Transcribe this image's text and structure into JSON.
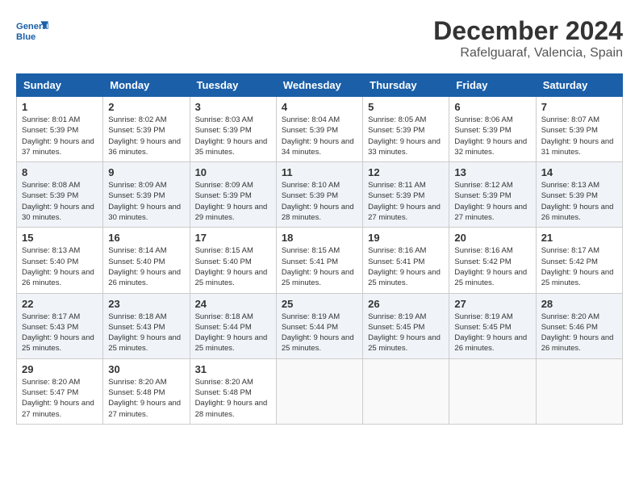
{
  "logo": {
    "name": "GeneralBlue",
    "alt": "General Blue Logo"
  },
  "title": "December 2024",
  "subtitle": "Rafelguaraf, Valencia, Spain",
  "weekdays": [
    "Sunday",
    "Monday",
    "Tuesday",
    "Wednesday",
    "Thursday",
    "Friday",
    "Saturday"
  ],
  "weeks": [
    [
      {
        "day": 1,
        "sunrise": "Sunrise: 8:01 AM",
        "sunset": "Sunset: 5:39 PM",
        "daylight": "Daylight: 9 hours and 37 minutes."
      },
      {
        "day": 2,
        "sunrise": "Sunrise: 8:02 AM",
        "sunset": "Sunset: 5:39 PM",
        "daylight": "Daylight: 9 hours and 36 minutes."
      },
      {
        "day": 3,
        "sunrise": "Sunrise: 8:03 AM",
        "sunset": "Sunset: 5:39 PM",
        "daylight": "Daylight: 9 hours and 35 minutes."
      },
      {
        "day": 4,
        "sunrise": "Sunrise: 8:04 AM",
        "sunset": "Sunset: 5:39 PM",
        "daylight": "Daylight: 9 hours and 34 minutes."
      },
      {
        "day": 5,
        "sunrise": "Sunrise: 8:05 AM",
        "sunset": "Sunset: 5:39 PM",
        "daylight": "Daylight: 9 hours and 33 minutes."
      },
      {
        "day": 6,
        "sunrise": "Sunrise: 8:06 AM",
        "sunset": "Sunset: 5:39 PM",
        "daylight": "Daylight: 9 hours and 32 minutes."
      },
      {
        "day": 7,
        "sunrise": "Sunrise: 8:07 AM",
        "sunset": "Sunset: 5:39 PM",
        "daylight": "Daylight: 9 hours and 31 minutes."
      }
    ],
    [
      {
        "day": 8,
        "sunrise": "Sunrise: 8:08 AM",
        "sunset": "Sunset: 5:39 PM",
        "daylight": "Daylight: 9 hours and 30 minutes."
      },
      {
        "day": 9,
        "sunrise": "Sunrise: 8:09 AM",
        "sunset": "Sunset: 5:39 PM",
        "daylight": "Daylight: 9 hours and 30 minutes."
      },
      {
        "day": 10,
        "sunrise": "Sunrise: 8:09 AM",
        "sunset": "Sunset: 5:39 PM",
        "daylight": "Daylight: 9 hours and 29 minutes."
      },
      {
        "day": 11,
        "sunrise": "Sunrise: 8:10 AM",
        "sunset": "Sunset: 5:39 PM",
        "daylight": "Daylight: 9 hours and 28 minutes."
      },
      {
        "day": 12,
        "sunrise": "Sunrise: 8:11 AM",
        "sunset": "Sunset: 5:39 PM",
        "daylight": "Daylight: 9 hours and 27 minutes."
      },
      {
        "day": 13,
        "sunrise": "Sunrise: 8:12 AM",
        "sunset": "Sunset: 5:39 PM",
        "daylight": "Daylight: 9 hours and 27 minutes."
      },
      {
        "day": 14,
        "sunrise": "Sunrise: 8:13 AM",
        "sunset": "Sunset: 5:39 PM",
        "daylight": "Daylight: 9 hours and 26 minutes."
      }
    ],
    [
      {
        "day": 15,
        "sunrise": "Sunrise: 8:13 AM",
        "sunset": "Sunset: 5:40 PM",
        "daylight": "Daylight: 9 hours and 26 minutes."
      },
      {
        "day": 16,
        "sunrise": "Sunrise: 8:14 AM",
        "sunset": "Sunset: 5:40 PM",
        "daylight": "Daylight: 9 hours and 26 minutes."
      },
      {
        "day": 17,
        "sunrise": "Sunrise: 8:15 AM",
        "sunset": "Sunset: 5:40 PM",
        "daylight": "Daylight: 9 hours and 25 minutes."
      },
      {
        "day": 18,
        "sunrise": "Sunrise: 8:15 AM",
        "sunset": "Sunset: 5:41 PM",
        "daylight": "Daylight: 9 hours and 25 minutes."
      },
      {
        "day": 19,
        "sunrise": "Sunrise: 8:16 AM",
        "sunset": "Sunset: 5:41 PM",
        "daylight": "Daylight: 9 hours and 25 minutes."
      },
      {
        "day": 20,
        "sunrise": "Sunrise: 8:16 AM",
        "sunset": "Sunset: 5:42 PM",
        "daylight": "Daylight: 9 hours and 25 minutes."
      },
      {
        "day": 21,
        "sunrise": "Sunrise: 8:17 AM",
        "sunset": "Sunset: 5:42 PM",
        "daylight": "Daylight: 9 hours and 25 minutes."
      }
    ],
    [
      {
        "day": 22,
        "sunrise": "Sunrise: 8:17 AM",
        "sunset": "Sunset: 5:43 PM",
        "daylight": "Daylight: 9 hours and 25 minutes."
      },
      {
        "day": 23,
        "sunrise": "Sunrise: 8:18 AM",
        "sunset": "Sunset: 5:43 PM",
        "daylight": "Daylight: 9 hours and 25 minutes."
      },
      {
        "day": 24,
        "sunrise": "Sunrise: 8:18 AM",
        "sunset": "Sunset: 5:44 PM",
        "daylight": "Daylight: 9 hours and 25 minutes."
      },
      {
        "day": 25,
        "sunrise": "Sunrise: 8:19 AM",
        "sunset": "Sunset: 5:44 PM",
        "daylight": "Daylight: 9 hours and 25 minutes."
      },
      {
        "day": 26,
        "sunrise": "Sunrise: 8:19 AM",
        "sunset": "Sunset: 5:45 PM",
        "daylight": "Daylight: 9 hours and 25 minutes."
      },
      {
        "day": 27,
        "sunrise": "Sunrise: 8:19 AM",
        "sunset": "Sunset: 5:45 PM",
        "daylight": "Daylight: 9 hours and 26 minutes."
      },
      {
        "day": 28,
        "sunrise": "Sunrise: 8:20 AM",
        "sunset": "Sunset: 5:46 PM",
        "daylight": "Daylight: 9 hours and 26 minutes."
      }
    ],
    [
      {
        "day": 29,
        "sunrise": "Sunrise: 8:20 AM",
        "sunset": "Sunset: 5:47 PM",
        "daylight": "Daylight: 9 hours and 27 minutes."
      },
      {
        "day": 30,
        "sunrise": "Sunrise: 8:20 AM",
        "sunset": "Sunset: 5:48 PM",
        "daylight": "Daylight: 9 hours and 27 minutes."
      },
      {
        "day": 31,
        "sunrise": "Sunrise: 8:20 AM",
        "sunset": "Sunset: 5:48 PM",
        "daylight": "Daylight: 9 hours and 28 minutes."
      },
      null,
      null,
      null,
      null
    ]
  ]
}
